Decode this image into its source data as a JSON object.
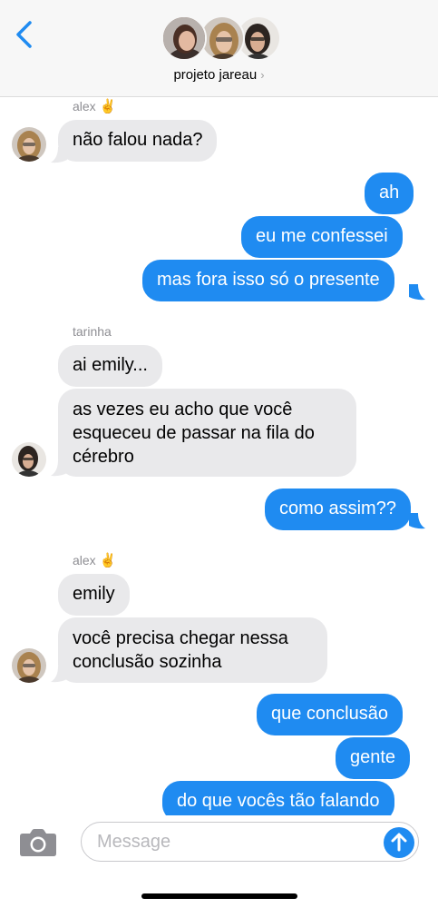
{
  "header": {
    "group_name": "projeto jareau",
    "chevron": "›",
    "back_icon": "chevron-left-icon"
  },
  "messages": [
    {
      "sender": "alex",
      "sender_emoji": "✌️",
      "direction": "incoming",
      "text": "não falou nada?"
    },
    {
      "direction": "outgoing",
      "text": "ah"
    },
    {
      "direction": "outgoing",
      "text": "eu me confessei"
    },
    {
      "direction": "outgoing",
      "text": "mas fora isso só o presente"
    },
    {
      "sender": "tarinha",
      "direction": "incoming",
      "text": "ai emily..."
    },
    {
      "direction": "incoming",
      "text": "as vezes eu acho que você esqueceu de passar na fila do cérebro"
    },
    {
      "direction": "outgoing",
      "text": "como assim??"
    },
    {
      "sender": "alex",
      "sender_emoji": "✌️",
      "direction": "incoming",
      "text": "emily"
    },
    {
      "direction": "incoming",
      "text": "você precisa chegar nessa conclusão sozinha"
    },
    {
      "direction": "outgoing",
      "text": "que conclusão"
    },
    {
      "direction": "outgoing",
      "text": "gente"
    },
    {
      "direction": "outgoing",
      "text": "do que vocês tão falando"
    }
  ],
  "composer": {
    "placeholder": "Message",
    "camera_icon": "camera-icon",
    "send_icon": "arrow-up-icon"
  },
  "colors": {
    "outgoing": "#1f8bf1",
    "incoming": "#e9e9eb",
    "accent": "#1f8bf1"
  }
}
